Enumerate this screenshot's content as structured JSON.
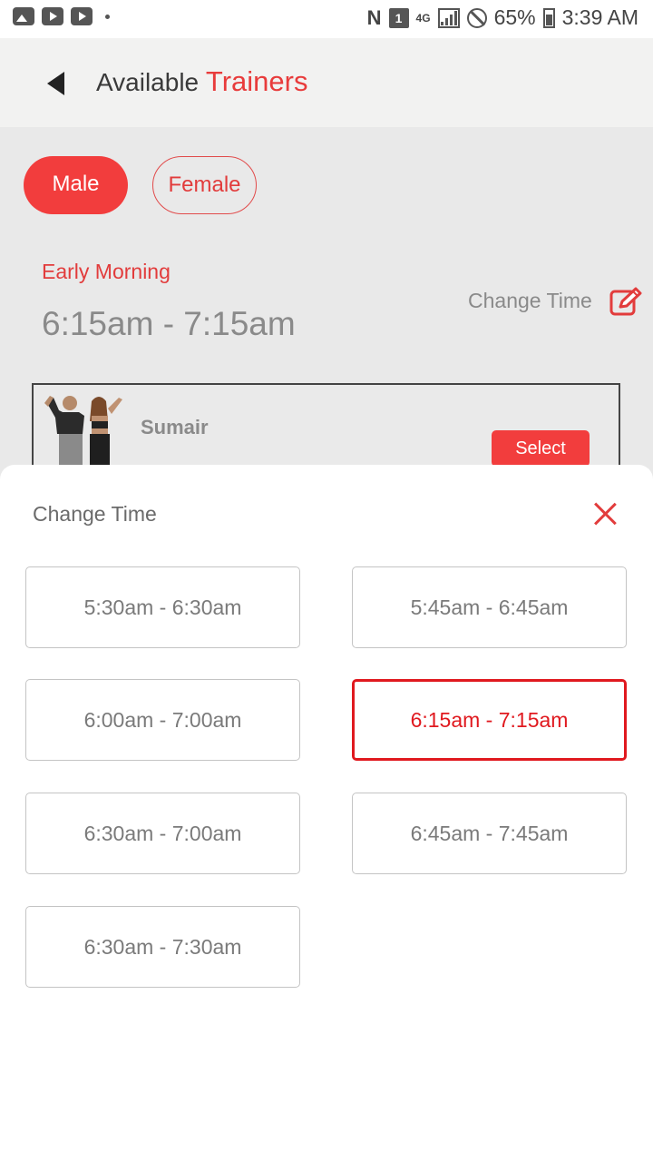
{
  "status_bar": {
    "battery": "65%",
    "time": "3:39 AM",
    "sim_slot": "1",
    "network": "4G"
  },
  "header": {
    "title_prefix": "Available",
    "title_accent": "Trainers",
    "accent_color": "#e83b3b"
  },
  "gender": {
    "male": "Male",
    "female": "Female",
    "selected": "Male"
  },
  "current_slot": {
    "label": "Early Morning",
    "time": "6:15am - 7:15am",
    "change_time": "Change Time"
  },
  "trainer": {
    "name": "Sumair",
    "select_label": "Select"
  },
  "sheet": {
    "title": "Change Time",
    "slots": [
      "5:30am - 6:30am",
      "5:45am - 6:45am",
      "6:00am - 7:00am",
      "6:15am - 7:15am",
      "6:30am - 7:00am",
      "6:45am - 7:45am",
      "6:30am - 7:30am"
    ],
    "selected_slot": "6:15am - 7:15am"
  }
}
